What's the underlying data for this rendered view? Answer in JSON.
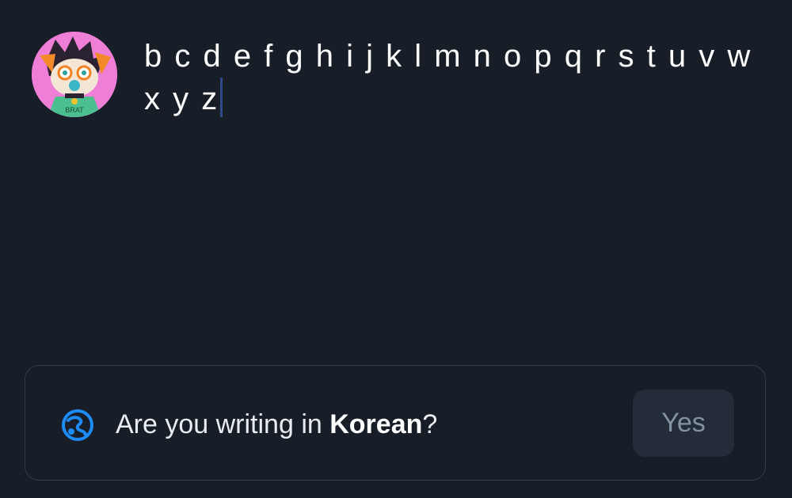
{
  "composer": {
    "text": "b c d e f g h i j k l m n o p q r s t u v w x y z"
  },
  "avatar": {
    "icon": "user-avatar",
    "badge_text": "BRAT"
  },
  "language_prompt": {
    "icon": "globe-icon",
    "text_before": "Are you writing in ",
    "language": "Korean",
    "text_after": "?",
    "yes_label": "Yes"
  },
  "colors": {
    "background": "#171e28",
    "banner_border": "#323b48",
    "button_bg": "#232c38",
    "button_text": "#8391a3",
    "accent": "#1d8cf8",
    "caret": "#2f4a86"
  }
}
